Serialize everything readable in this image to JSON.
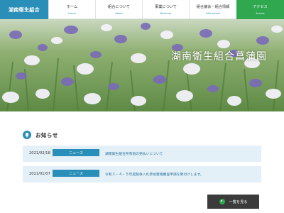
{
  "header": {
    "logo_text": "湖南衛生組合",
    "nav": [
      {
        "jp": "ホーム",
        "en": "Home"
      },
      {
        "jp": "組合について",
        "en": "About"
      },
      {
        "jp": "事業について",
        "en": "Business"
      },
      {
        "jp": "組合議会・組合情報",
        "en": "Information"
      },
      {
        "jp": "アクセス",
        "en": "Access"
      }
    ]
  },
  "hero": {
    "title": "湖南衛生組合菖蒲園"
  },
  "news": {
    "heading": "お知らせ",
    "items": [
      {
        "date": "2021/02/18",
        "category": "ニュース",
        "text": "湖南衛生組合所有地の売払いについて"
      },
      {
        "date": "2021/01/07",
        "category": "ニュース",
        "text": "令和３・４・５年度競争入札参加資格審査申請を受付けします。"
      }
    ],
    "more_label": "一覧を見る"
  },
  "colors": {
    "brand_blue": "#2a8fb8",
    "access_green": "#2fa84f",
    "news_row_bg": "#e3f0f7",
    "more_button_bg": "#3b3b3b"
  }
}
